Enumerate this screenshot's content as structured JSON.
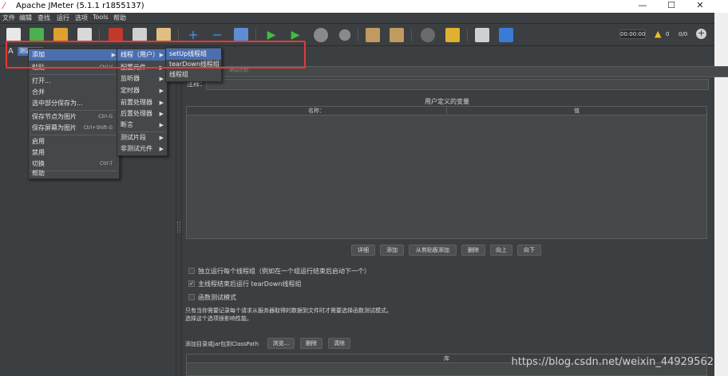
{
  "window": {
    "title": "Apache JMeter (5.1.1 r1855137)",
    "minimize": "—",
    "maximize": "☐",
    "close": "✕"
  },
  "menubar": [
    "文件",
    "编辑",
    "查找",
    "运行",
    "选项",
    "Tools",
    "帮助"
  ],
  "toolbar": {
    "elapsed": "00:00:00",
    "warnings": "0",
    "threads": "0/0"
  },
  "tree": {
    "root_label": "测试计划"
  },
  "context_menu": {
    "items": [
      {
        "label": "添加",
        "submenu": true
      },
      {
        "label": "粘贴",
        "shortcut": "Ctrl-V"
      },
      {
        "label": "打开..."
      },
      {
        "label": "合并"
      },
      {
        "label": "选中部分保存为..."
      },
      {
        "label": "保存节点为图片",
        "shortcut": "Ctrl-G"
      },
      {
        "label": "保存屏幕为图片",
        "shortcut": "Ctrl+Shift-G"
      },
      {
        "label": "启用"
      },
      {
        "label": "禁用"
      },
      {
        "label": "切换",
        "shortcut": "Ctrl-T"
      },
      {
        "label": "帮助"
      }
    ]
  },
  "add_submenu": {
    "items": [
      {
        "label": "线程（用户）"
      },
      {
        "label": "配置元件"
      },
      {
        "label": "监听器"
      },
      {
        "label": "定时器"
      },
      {
        "label": "前置处理器"
      },
      {
        "label": "后置处理器"
      },
      {
        "label": "断言"
      },
      {
        "label": "测试片段"
      },
      {
        "label": "非测试元件"
      }
    ]
  },
  "thread_submenu": {
    "items": [
      {
        "label": "setUp线程组"
      },
      {
        "label": "tearDown线程组"
      },
      {
        "label": "线程组"
      }
    ]
  },
  "right_panel": {
    "name_value": "测试计划",
    "comment_label": "注释：",
    "udv_title": "用户定义的变量",
    "col_name": "名称：",
    "col_value": "值",
    "buttons": [
      "详细",
      "添加",
      "从剪贴板添加",
      "删除",
      "向上",
      "向下"
    ],
    "checkboxes": [
      {
        "label": "独立运行每个线程组（例如在一个组运行结束后启动下一个）",
        "checked": false
      },
      {
        "label": "主线程结束后运行 tearDown线程组",
        "checked": true
      },
      {
        "label": "函数测试模式",
        "checked": false
      }
    ],
    "note_line1": "只有当你需要记录每个请求从服务器取得的数据到文件时才需要选择函数测试模式。",
    "note_line2": "选择这个选项很影响性能。",
    "classpath_label": "添加目录或jar包到ClassPath",
    "classpath_buttons": [
      "浏览...",
      "删除",
      "清除"
    ],
    "lib_header": "库"
  },
  "watermark": "https://blog.csdn.net/weixin_44929562",
  "colors": {
    "background": "#3c3f41",
    "highlight": "#4b6eaf",
    "annotation": "#e53935"
  }
}
